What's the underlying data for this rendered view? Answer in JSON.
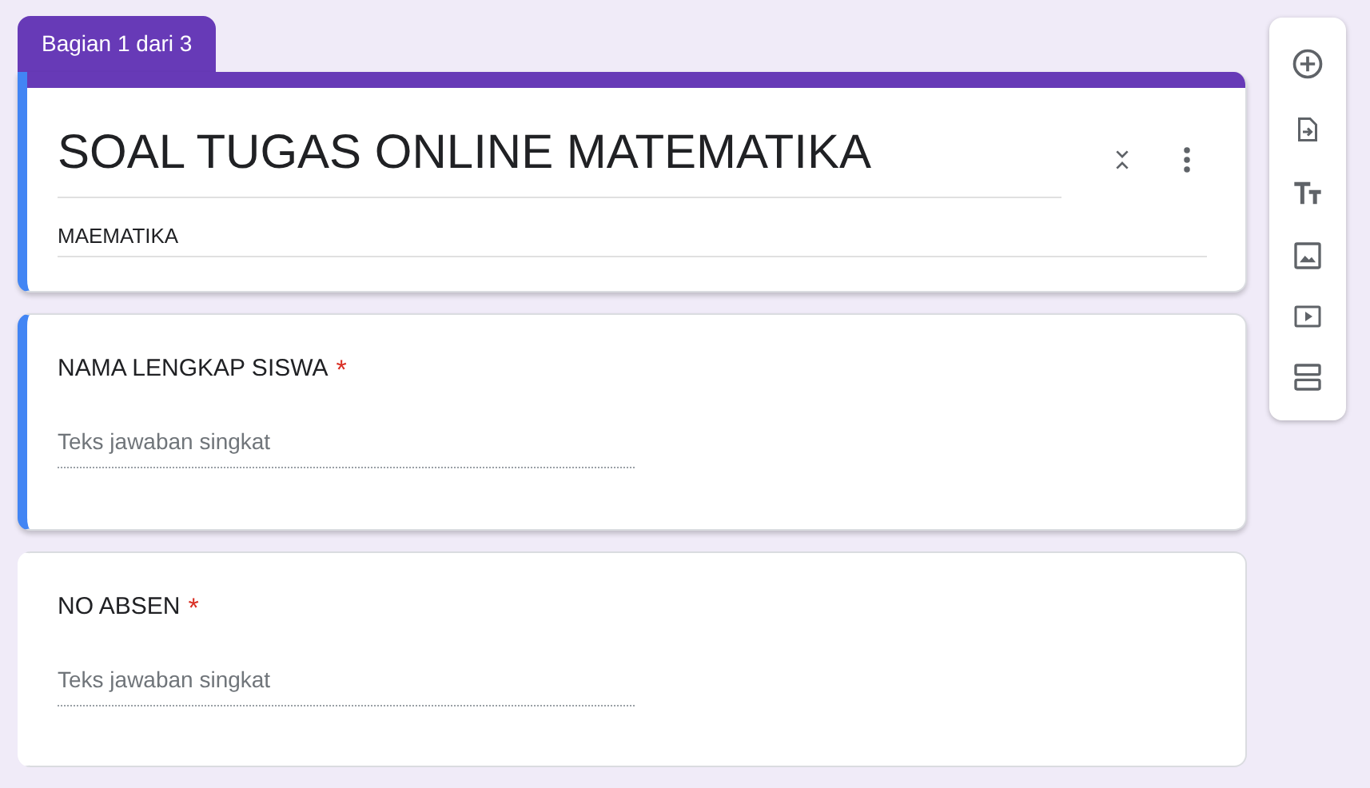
{
  "section_tab": {
    "label": "Bagian 1 dari 3"
  },
  "form_header": {
    "title": "SOAL TUGAS ONLINE MATEMATIKA",
    "description": "MAEMATIKA",
    "selected": true
  },
  "questions": [
    {
      "title": "NAMA LENGKAP SISWA",
      "required_mark": "*",
      "placeholder": "Teks jawaban singkat",
      "selected": true
    },
    {
      "title": "NO ABSEN",
      "required_mark": "*",
      "placeholder": "Teks jawaban singkat",
      "selected": false
    }
  ],
  "toolbar": [
    {
      "kind": "add"
    },
    {
      "kind": "import"
    },
    {
      "kind": "text"
    },
    {
      "kind": "image"
    },
    {
      "kind": "video"
    },
    {
      "kind": "section"
    }
  ]
}
